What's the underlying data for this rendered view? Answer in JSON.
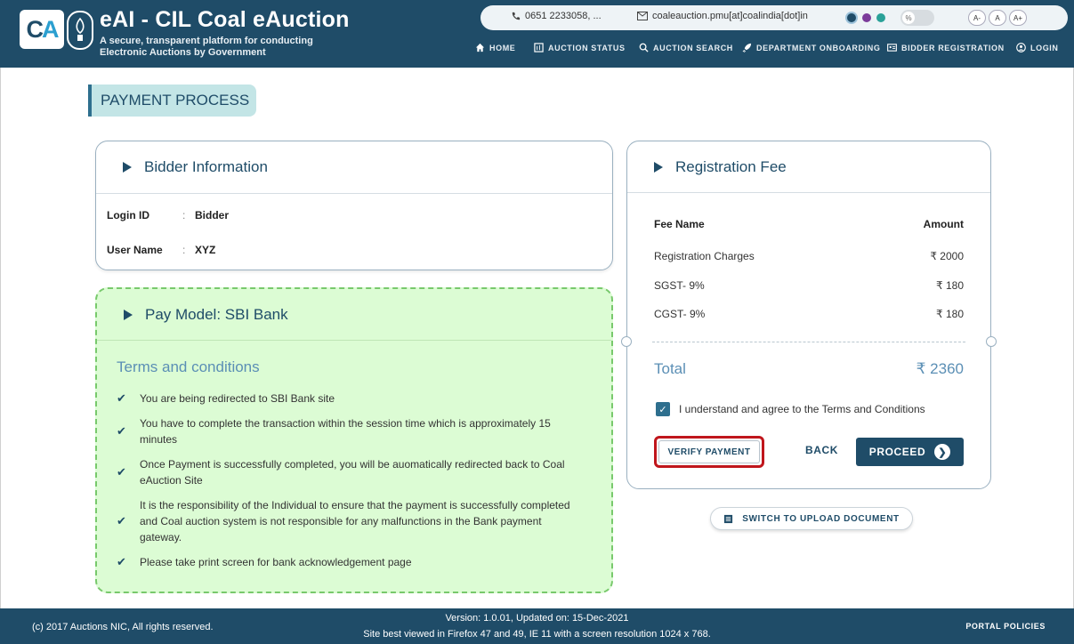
{
  "header": {
    "logo_text_c": "C",
    "logo_text_a": "A",
    "title": "eAI - CIL Coal eAuction",
    "subtitle": "A secure, transparent platform for conducting Electronic Auctions by Government",
    "phone": "0651 2233058, ...",
    "email": "coaleauction.pmu[at]coalindia[dot]in",
    "toggle_glyph": "%",
    "font_decrease": "A-",
    "font_normal": "A",
    "font_increase": "A+",
    "theme_colors": [
      "#1f4c68",
      "#7b3b9a",
      "#2aa198"
    ],
    "nav": {
      "home": "HOME",
      "auction_status": "AUCTION STATUS",
      "auction_search": "AUCTION SEARCH",
      "department_onboarding": "DEPARTMENT ONBOARDING",
      "bidder_registration": "BIDDER REGISTRATION",
      "login": "LOGIN"
    }
  },
  "page_title": "PAYMENT PROCESS",
  "bidder_info": {
    "heading": "Bidder Information",
    "login_id_label": "Login ID",
    "login_id_value": "Bidder",
    "user_name_label": "User Name",
    "user_name_value": "XYZ",
    "separator": ":"
  },
  "pay_model": {
    "heading": "Pay Model: SBI Bank",
    "terms_title": "Terms and conditions",
    "terms": [
      "You are being redirected to SBI Bank site",
      "You have to complete the transaction within the session time which is approximately 15 minutes",
      "Once Payment is successfully completed, you will be auomatically redirected back to Coal eAuction Site",
      "It is the responsibility of the Individual to ensure that the payment is successfully completed and Coal auction system is not responsible for any malfunctions in the Bank payment gateway.",
      "Please take print screen for bank acknowledgement page"
    ]
  },
  "registration_fee": {
    "heading": "Registration Fee",
    "col_fee_name": "Fee Name",
    "col_amount": "Amount",
    "rows": [
      {
        "name": "Registration Charges",
        "amount": "₹ 2000"
      },
      {
        "name": "SGST- 9%",
        "amount": "₹ 180"
      },
      {
        "name": "CGST- 9%",
        "amount": "₹ 180"
      }
    ],
    "total_label": "Total",
    "total_value": "₹ 2360",
    "agree_text": "I understand and agree to the Terms and Conditions",
    "agree_checked": true
  },
  "actions": {
    "verify": "VERIFY PAYMENT",
    "back": "BACK",
    "proceed": "PROCEED",
    "switch_upload": "SWITCH TO UPLOAD DOCUMENT"
  },
  "footer": {
    "copyright": "(c) 2017 Auctions NIC, All rights reserved.",
    "version": "Version: 1.0.01, Updated on: 15-Dec-2021",
    "best_viewed": "Site best viewed in Firefox 47 and 49, IE 11 with a screen resolution 1024 x 768.",
    "policies": "PORTAL POLICIES"
  }
}
